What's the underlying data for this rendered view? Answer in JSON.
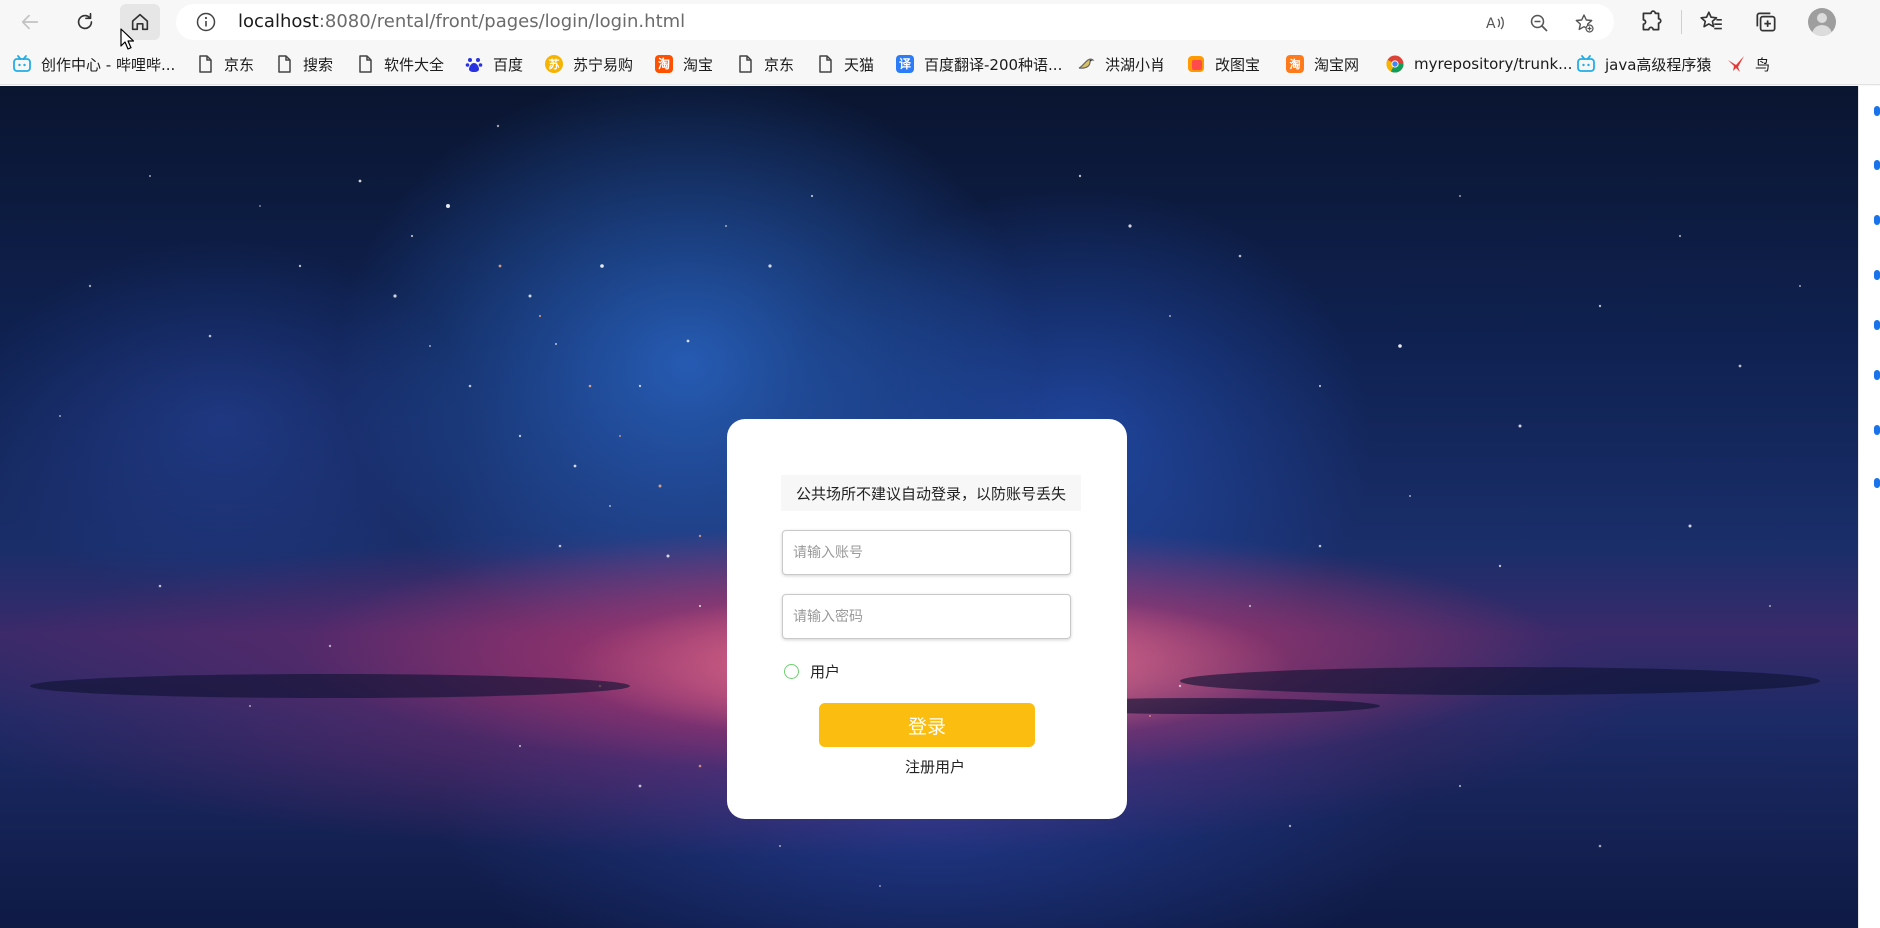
{
  "browser": {
    "url_host": "localhost",
    "url_rest": ":8080/rental/front/pages/login/login.html",
    "icons": {
      "back": "back-arrow-icon",
      "refresh": "refresh-icon",
      "home": "home-icon",
      "info": "site-info-icon",
      "read_aloud": "read-aloud-icon",
      "zoom": "zoom-out-icon",
      "favorite_add": "add-favorite-icon",
      "extensions": "extensions-icon",
      "favorites": "favorites-icon",
      "collections": "collections-icon",
      "profile": "profile-avatar-icon"
    }
  },
  "bookmarks": [
    {
      "label": "创作中心 - 哔哩哔...",
      "icon": "bilibili-icon",
      "color": "#23ade5"
    },
    {
      "label": "京东",
      "icon": "page-icon",
      "color": "#555555"
    },
    {
      "label": "搜索",
      "icon": "page-icon",
      "color": "#555555"
    },
    {
      "label": "软件大全",
      "icon": "page-icon",
      "color": "#555555"
    },
    {
      "label": "百度",
      "icon": "baidu-paw-icon",
      "color": "#2932e1"
    },
    {
      "label": "苏宁易购",
      "icon": "suning-icon",
      "color": "#f6b300"
    },
    {
      "label": "淘宝",
      "icon": "taobao-icon",
      "color": "#ff5000"
    },
    {
      "label": "京东",
      "icon": "page-icon",
      "color": "#555555"
    },
    {
      "label": "天猫",
      "icon": "page-icon",
      "color": "#555555"
    },
    {
      "label": "百度翻译-200种语...",
      "icon": "baidu-translate-icon",
      "color": "#2b7cf6"
    },
    {
      "label": "洪湖小肖",
      "icon": "bird-icon",
      "color": "#777777"
    },
    {
      "label": "改图宝",
      "icon": "gaitubao-icon",
      "color": "#ff9a00"
    },
    {
      "label": "淘宝网",
      "icon": "taobao-icon",
      "color": "#ff5000"
    },
    {
      "label": "myrepository/trunk...",
      "icon": "chrome-icon",
      "color": "#db4437"
    },
    {
      "label": "java高级程序猿",
      "icon": "bilibili-icon",
      "color": "#23ade5"
    },
    {
      "label": "鸟",
      "icon": "bird-red-icon",
      "color": "#e53935"
    }
  ],
  "login": {
    "notice": "公共场所不建议自动登录，以防账号丢失",
    "account_placeholder": "请输入账号",
    "password_placeholder": "请输入密码",
    "role_label": "用户",
    "login_button": "登录",
    "register_link": "注册用户",
    "accent_color": "#fbbd10"
  }
}
